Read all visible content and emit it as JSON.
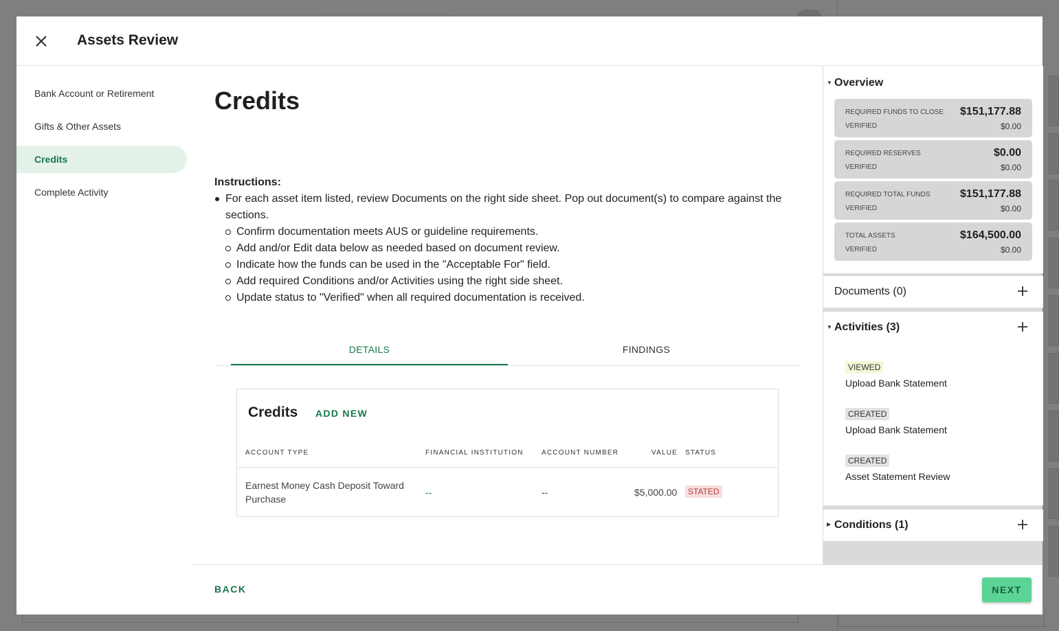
{
  "header": {
    "title": "Assets Review"
  },
  "nav": [
    {
      "label": "Bank Account or Retirement"
    },
    {
      "label": "Gifts & Other Assets"
    },
    {
      "label": "Credits"
    },
    {
      "label": "Complete Activity"
    }
  ],
  "main": {
    "heading": "Credits",
    "instructions": {
      "title": "Instructions:",
      "main": "For each asset item listed, review Documents on the right side sheet. Pop out document(s) to compare against the sections.",
      "sub": [
        "Confirm documentation meets AUS or guideline requirements.",
        "Add and/or Edit data below as needed based on document review.",
        "Indicate how the funds can be used in the \"Acceptable For\" field.",
        "Add required Conditions and/or Activities using the right side sheet.",
        "Update status to \"Verified\" when all required documentation is received."
      ]
    },
    "tabs": [
      {
        "label": "DETAILS"
      },
      {
        "label": "FINDINGS"
      }
    ],
    "card": {
      "title": "Credits",
      "add_new": "ADD NEW",
      "columns": [
        "ACCOUNT TYPE",
        "FINANCIAL INSTITUTION",
        "ACCOUNT NUMBER",
        "VALUE",
        "STATUS"
      ],
      "rows": [
        {
          "account_type": "Earnest Money Cash Deposit Toward Purchase",
          "institution": "--",
          "account_number": "--",
          "value": "$5,000.00",
          "status": "STATED"
        }
      ]
    }
  },
  "footer": {
    "back": "BACK",
    "next": "NEXT"
  },
  "side": {
    "overview": {
      "title": "Overview",
      "cards": [
        {
          "label": "REQUIRED FUNDS TO CLOSE",
          "value": "$151,177.88",
          "verified_label": "VERIFIED",
          "verified_value": "$0.00"
        },
        {
          "label": "REQUIRED RESERVES",
          "value": "$0.00",
          "verified_label": "VERIFIED",
          "verified_value": "$0.00"
        },
        {
          "label": "REQUIRED TOTAL FUNDS",
          "value": "$151,177.88",
          "verified_label": "VERIFIED",
          "verified_value": "$0.00"
        },
        {
          "label": "TOTAL ASSETS",
          "value": "$164,500.00",
          "verified_label": "VERIFIED",
          "verified_value": "$0.00"
        }
      ]
    },
    "documents": {
      "title": "Documents (0)"
    },
    "activities": {
      "title": "Activities (3)",
      "items": [
        {
          "badge": "VIEWED",
          "text": "Upload Bank Statement"
        },
        {
          "badge": "CREATED",
          "text": "Upload Bank Statement"
        },
        {
          "badge": "CREATED",
          "text": "Asset Statement Review"
        }
      ]
    },
    "conditions": {
      "title": "Conditions (1)"
    }
  },
  "colors": {
    "accent": "#17784a",
    "next_button": "#5bd496",
    "status_stated_bg": "#f8dede"
  }
}
